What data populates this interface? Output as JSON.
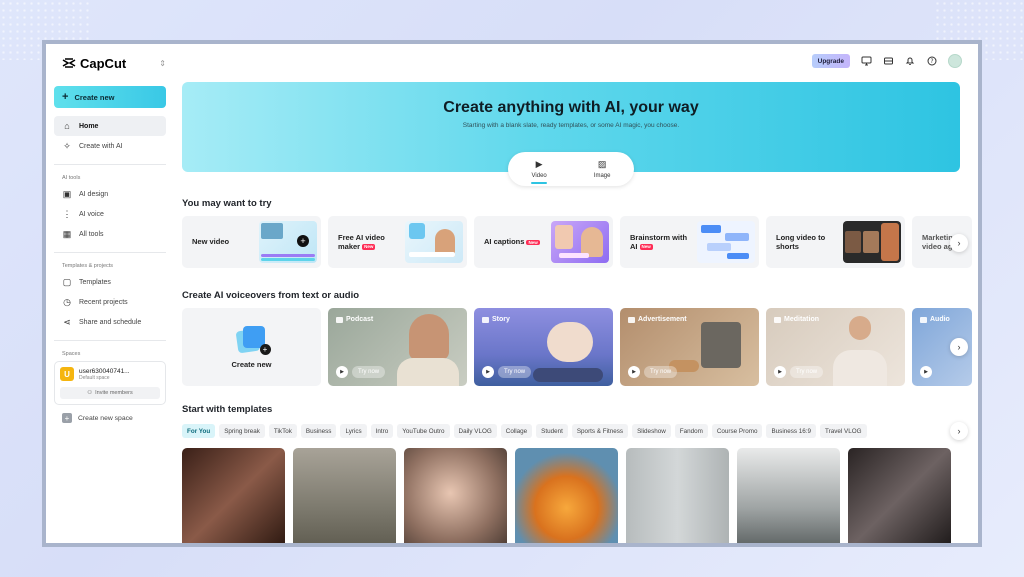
{
  "app": {
    "name": "CapCut"
  },
  "sidebar": {
    "create_new": "Create new",
    "main_items": [
      {
        "label": "Home",
        "icon": "home-icon"
      },
      {
        "label": "Create with AI",
        "icon": "sparkle-icon"
      }
    ],
    "ai_tools_title": "AI tools",
    "ai_tools": [
      {
        "label": "AI design",
        "icon": "image-icon"
      },
      {
        "label": "AI voice",
        "icon": "waveform-icon"
      },
      {
        "label": "All tools",
        "icon": "grid-icon"
      }
    ],
    "projects_title": "Templates & projects",
    "projects": [
      {
        "label": "Templates",
        "icon": "template-icon"
      },
      {
        "label": "Recent projects",
        "icon": "clock-icon"
      },
      {
        "label": "Share and schedule",
        "icon": "share-icon"
      }
    ],
    "spaces_title": "Spaces",
    "space": {
      "avatar_letter": "U",
      "name": "user630040741...",
      "sub": "Default space",
      "invite": "Invite members"
    },
    "new_space": "Create new space"
  },
  "topbar": {
    "upgrade": "Upgrade"
  },
  "hero": {
    "title": "Create anything with AI, your way",
    "subtitle": "Starting with a blank slate, ready templates, or some AI magic, you choose.",
    "tabs": [
      {
        "label": "Video"
      },
      {
        "label": "Image"
      }
    ]
  },
  "try_section": {
    "title": "You may want to try",
    "cards": [
      {
        "label": "New video",
        "new": ""
      },
      {
        "label": "Free AI video maker",
        "new": "New"
      },
      {
        "label": "AI captions",
        "new": "New"
      },
      {
        "label": "Brainstorm with AI",
        "new": "New"
      },
      {
        "label": "Long video to shorts",
        "new": ""
      },
      {
        "label": "Marketing video ag",
        "new": ""
      }
    ]
  },
  "voiceover_section": {
    "title": "Create AI voiceovers from text or audio",
    "create_new": "Create new",
    "try_now": "Try now",
    "cards": [
      {
        "label": "Podcast"
      },
      {
        "label": "Story"
      },
      {
        "label": "Advertisement"
      },
      {
        "label": "Meditation"
      },
      {
        "label": "Audio"
      }
    ]
  },
  "templates_section": {
    "title": "Start with templates",
    "chips": [
      "For You",
      "Spring break",
      "TikTok",
      "Business",
      "Lyrics",
      "Intro",
      "YouTube Outro",
      "Daily VLOG",
      "Collage",
      "Student",
      "Sports & Fitness",
      "Slideshow",
      "Fandom",
      "Course Promo",
      "Business 16:9",
      "Travel VLOG"
    ]
  },
  "colors": {
    "accent": "#2ec4e2",
    "new_badge": "#fe2c55"
  }
}
